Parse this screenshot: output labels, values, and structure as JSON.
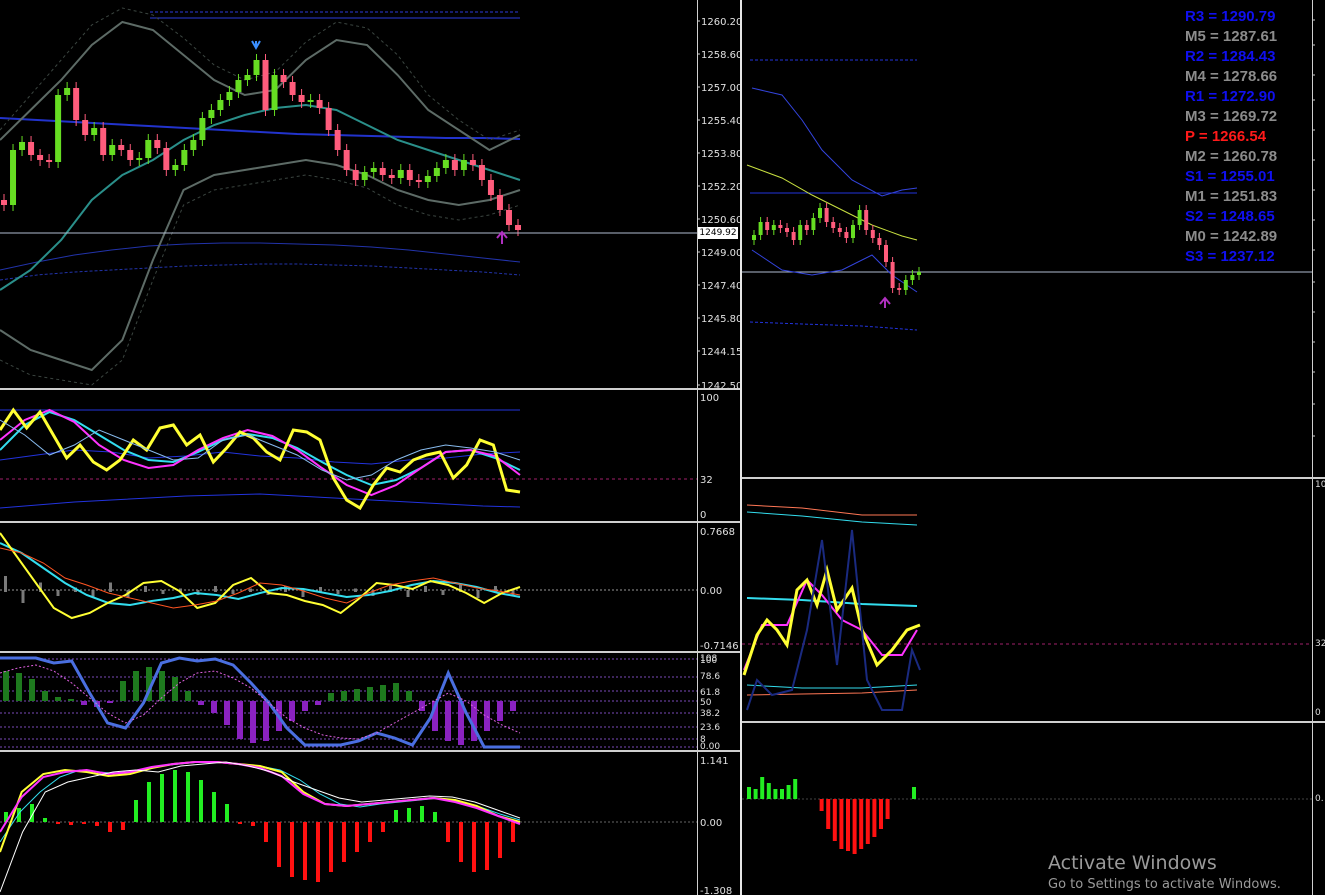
{
  "left_chart": {
    "price_axis": [
      "1260.20",
      "1258.60",
      "1257.00",
      "1255.40",
      "1253.80",
      "1252.20",
      "1250.60",
      "1249.00",
      "1247.40",
      "1245.80",
      "1244.15",
      "1242.50"
    ],
    "current_price": "1249.92",
    "rsi_axis": [
      "100",
      "32",
      "0"
    ],
    "osc_axis": [
      "0.7668",
      "0.00",
      "-0.7146"
    ],
    "fib_axis": [
      "100",
      "78.6",
      "61.8",
      "50",
      "38.2",
      "23.6",
      "8",
      "0.00"
    ],
    "fib_axis_top2": "108",
    "macd_axis": [
      "1.141",
      "0.00",
      "-1.308"
    ]
  },
  "right_chart": {
    "pivots": [
      {
        "label": "R3 = 1290.79",
        "color": "#1010ee"
      },
      {
        "label": "M5 = 1287.61",
        "color": "#8c8c8c"
      },
      {
        "label": "R2 = 1284.43",
        "color": "#1010ee"
      },
      {
        "label": "M4 = 1278.66",
        "color": "#8c8c8c"
      },
      {
        "label": "R1 = 1272.90",
        "color": "#1010ee"
      },
      {
        "label": "M3 = 1269.72",
        "color": "#8c8c8c"
      },
      {
        "label": "P  = 1266.54",
        "color": "#ff1a1a"
      },
      {
        "label": "M2 = 1260.78",
        "color": "#8c8c8c"
      },
      {
        "label": "S1 = 1255.01",
        "color": "#1010ee"
      },
      {
        "label": "M1 = 1251.83",
        "color": "#8c8c8c"
      },
      {
        "label": "S2 = 1248.65",
        "color": "#1010ee"
      },
      {
        "label": "M0 = 1242.89",
        "color": "#8c8c8c"
      },
      {
        "label": "S3 = 1237.12",
        "color": "#1010ee"
      }
    ],
    "rsi_axis_top": "10",
    "rsi_level": "32",
    "rsi_axis_bottom": "0",
    "macd_zero": "0."
  },
  "watermark": {
    "title": "Activate Windows",
    "subtitle": "Go to Settings to activate Windows."
  },
  "colors": {
    "bull": "#66dd22",
    "bear": "#ff5c7c",
    "yellow": "#ffff33",
    "magenta": "#ff33ff",
    "cyan": "#33ddee",
    "blue": "#2233dd",
    "teal": "#2a8f8a",
    "grey_band": "#5d6b66",
    "green_hist": "#22ee22",
    "red_hist": "#ff1111"
  }
}
